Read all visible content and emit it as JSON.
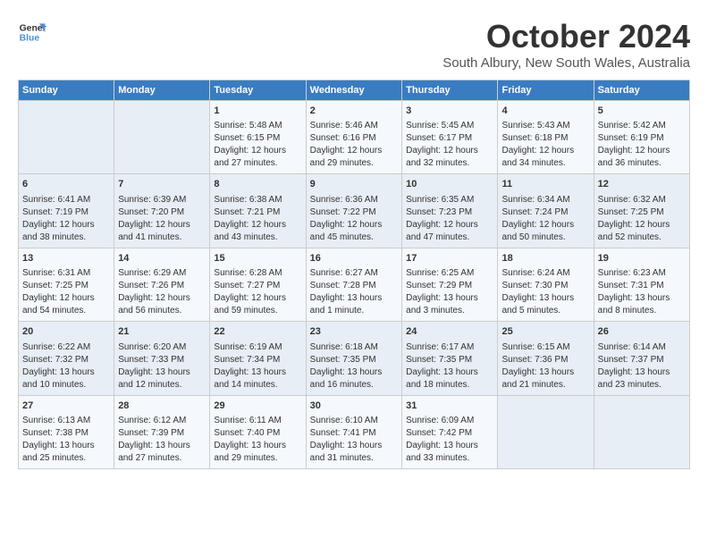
{
  "logo": {
    "line1": "General",
    "line2": "Blue"
  },
  "title": "October 2024",
  "subtitle": "South Albury, New South Wales, Australia",
  "days_of_week": [
    "Sunday",
    "Monday",
    "Tuesday",
    "Wednesday",
    "Thursday",
    "Friday",
    "Saturday"
  ],
  "weeks": [
    [
      {
        "day": "",
        "sunrise": "",
        "sunset": "",
        "daylight": ""
      },
      {
        "day": "",
        "sunrise": "",
        "sunset": "",
        "daylight": ""
      },
      {
        "day": "1",
        "sunrise": "Sunrise: 5:48 AM",
        "sunset": "Sunset: 6:15 PM",
        "daylight": "Daylight: 12 hours and 27 minutes."
      },
      {
        "day": "2",
        "sunrise": "Sunrise: 5:46 AM",
        "sunset": "Sunset: 6:16 PM",
        "daylight": "Daylight: 12 hours and 29 minutes."
      },
      {
        "day": "3",
        "sunrise": "Sunrise: 5:45 AM",
        "sunset": "Sunset: 6:17 PM",
        "daylight": "Daylight: 12 hours and 32 minutes."
      },
      {
        "day": "4",
        "sunrise": "Sunrise: 5:43 AM",
        "sunset": "Sunset: 6:18 PM",
        "daylight": "Daylight: 12 hours and 34 minutes."
      },
      {
        "day": "5",
        "sunrise": "Sunrise: 5:42 AM",
        "sunset": "Sunset: 6:19 PM",
        "daylight": "Daylight: 12 hours and 36 minutes."
      }
    ],
    [
      {
        "day": "6",
        "sunrise": "Sunrise: 6:41 AM",
        "sunset": "Sunset: 7:19 PM",
        "daylight": "Daylight: 12 hours and 38 minutes."
      },
      {
        "day": "7",
        "sunrise": "Sunrise: 6:39 AM",
        "sunset": "Sunset: 7:20 PM",
        "daylight": "Daylight: 12 hours and 41 minutes."
      },
      {
        "day": "8",
        "sunrise": "Sunrise: 6:38 AM",
        "sunset": "Sunset: 7:21 PM",
        "daylight": "Daylight: 12 hours and 43 minutes."
      },
      {
        "day": "9",
        "sunrise": "Sunrise: 6:36 AM",
        "sunset": "Sunset: 7:22 PM",
        "daylight": "Daylight: 12 hours and 45 minutes."
      },
      {
        "day": "10",
        "sunrise": "Sunrise: 6:35 AM",
        "sunset": "Sunset: 7:23 PM",
        "daylight": "Daylight: 12 hours and 47 minutes."
      },
      {
        "day": "11",
        "sunrise": "Sunrise: 6:34 AM",
        "sunset": "Sunset: 7:24 PM",
        "daylight": "Daylight: 12 hours and 50 minutes."
      },
      {
        "day": "12",
        "sunrise": "Sunrise: 6:32 AM",
        "sunset": "Sunset: 7:25 PM",
        "daylight": "Daylight: 12 hours and 52 minutes."
      }
    ],
    [
      {
        "day": "13",
        "sunrise": "Sunrise: 6:31 AM",
        "sunset": "Sunset: 7:25 PM",
        "daylight": "Daylight: 12 hours and 54 minutes."
      },
      {
        "day": "14",
        "sunrise": "Sunrise: 6:29 AM",
        "sunset": "Sunset: 7:26 PM",
        "daylight": "Daylight: 12 hours and 56 minutes."
      },
      {
        "day": "15",
        "sunrise": "Sunrise: 6:28 AM",
        "sunset": "Sunset: 7:27 PM",
        "daylight": "Daylight: 12 hours and 59 minutes."
      },
      {
        "day": "16",
        "sunrise": "Sunrise: 6:27 AM",
        "sunset": "Sunset: 7:28 PM",
        "daylight": "Daylight: 13 hours and 1 minute."
      },
      {
        "day": "17",
        "sunrise": "Sunrise: 6:25 AM",
        "sunset": "Sunset: 7:29 PM",
        "daylight": "Daylight: 13 hours and 3 minutes."
      },
      {
        "day": "18",
        "sunrise": "Sunrise: 6:24 AM",
        "sunset": "Sunset: 7:30 PM",
        "daylight": "Daylight: 13 hours and 5 minutes."
      },
      {
        "day": "19",
        "sunrise": "Sunrise: 6:23 AM",
        "sunset": "Sunset: 7:31 PM",
        "daylight": "Daylight: 13 hours and 8 minutes."
      }
    ],
    [
      {
        "day": "20",
        "sunrise": "Sunrise: 6:22 AM",
        "sunset": "Sunset: 7:32 PM",
        "daylight": "Daylight: 13 hours and 10 minutes."
      },
      {
        "day": "21",
        "sunrise": "Sunrise: 6:20 AM",
        "sunset": "Sunset: 7:33 PM",
        "daylight": "Daylight: 13 hours and 12 minutes."
      },
      {
        "day": "22",
        "sunrise": "Sunrise: 6:19 AM",
        "sunset": "Sunset: 7:34 PM",
        "daylight": "Daylight: 13 hours and 14 minutes."
      },
      {
        "day": "23",
        "sunrise": "Sunrise: 6:18 AM",
        "sunset": "Sunset: 7:35 PM",
        "daylight": "Daylight: 13 hours and 16 minutes."
      },
      {
        "day": "24",
        "sunrise": "Sunrise: 6:17 AM",
        "sunset": "Sunset: 7:35 PM",
        "daylight": "Daylight: 13 hours and 18 minutes."
      },
      {
        "day": "25",
        "sunrise": "Sunrise: 6:15 AM",
        "sunset": "Sunset: 7:36 PM",
        "daylight": "Daylight: 13 hours and 21 minutes."
      },
      {
        "day": "26",
        "sunrise": "Sunrise: 6:14 AM",
        "sunset": "Sunset: 7:37 PM",
        "daylight": "Daylight: 13 hours and 23 minutes."
      }
    ],
    [
      {
        "day": "27",
        "sunrise": "Sunrise: 6:13 AM",
        "sunset": "Sunset: 7:38 PM",
        "daylight": "Daylight: 13 hours and 25 minutes."
      },
      {
        "day": "28",
        "sunrise": "Sunrise: 6:12 AM",
        "sunset": "Sunset: 7:39 PM",
        "daylight": "Daylight: 13 hours and 27 minutes."
      },
      {
        "day": "29",
        "sunrise": "Sunrise: 6:11 AM",
        "sunset": "Sunset: 7:40 PM",
        "daylight": "Daylight: 13 hours and 29 minutes."
      },
      {
        "day": "30",
        "sunrise": "Sunrise: 6:10 AM",
        "sunset": "Sunset: 7:41 PM",
        "daylight": "Daylight: 13 hours and 31 minutes."
      },
      {
        "day": "31",
        "sunrise": "Sunrise: 6:09 AM",
        "sunset": "Sunset: 7:42 PM",
        "daylight": "Daylight: 13 hours and 33 minutes."
      },
      {
        "day": "",
        "sunrise": "",
        "sunset": "",
        "daylight": ""
      },
      {
        "day": "",
        "sunrise": "",
        "sunset": "",
        "daylight": ""
      }
    ]
  ]
}
